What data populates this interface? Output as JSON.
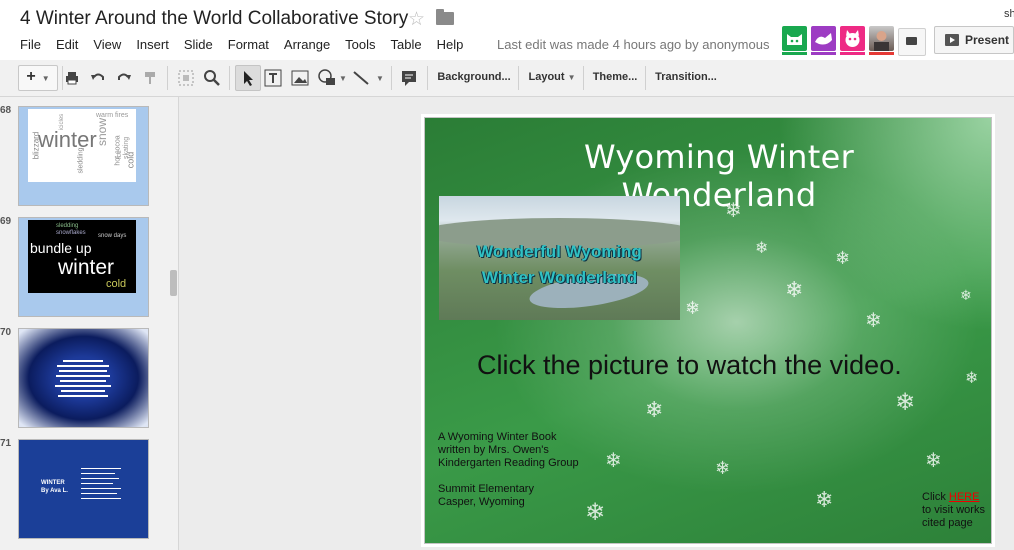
{
  "header": {
    "doc_title": "4 Winter Around the World Collaborative Story",
    "star_icon": "☆",
    "share_cut": "sh",
    "menu": [
      "File",
      "Edit",
      "View",
      "Insert",
      "Slide",
      "Format",
      "Arrange",
      "Tools",
      "Table",
      "Help"
    ],
    "last_edit": "Last edit was made 4 hours ago by anonymous",
    "present_label": "Present",
    "collaborators": [
      {
        "color": "#19a84f",
        "bar": "#19a84f",
        "glyph": "🐱"
      },
      {
        "color": "#9d3cc3",
        "bar": "#9d3cc3",
        "glyph": "🐈"
      },
      {
        "color": "#ee2a84",
        "bar": "#ee2a84",
        "glyph": "😺"
      },
      {
        "color": "#7a7a7a",
        "bar": "#e53935",
        "glyph": ""
      }
    ]
  },
  "toolbar": {
    "add_label": "+",
    "background_label": "Background...",
    "layout_label": "Layout",
    "theme_label": "Theme...",
    "transition_label": "Transition..."
  },
  "filmstrip": {
    "slides": [
      {
        "num": "68",
        "kind": "wordcloud-white",
        "words": [
          "winter",
          "snow",
          "blizzard",
          "cold",
          "hot cocoa",
          "warm fires",
          "ice skating",
          "sledding",
          "icicles"
        ]
      },
      {
        "num": "69",
        "kind": "wordcloud-black",
        "words": [
          "bundle up",
          "winter",
          "cold",
          "snowflakes",
          "sledding",
          "snow days"
        ]
      },
      {
        "num": "70",
        "kind": "blue-snow"
      },
      {
        "num": "71",
        "kind": "blue-text",
        "title": "WINTER",
        "author": "By Ava L."
      }
    ]
  },
  "slide": {
    "title": "Wyoming Winter Wonderland",
    "video_line1": "Wonderful Wyoming",
    "video_line2": "Winter Wonderland",
    "click_text": "Click the picture to watch the video.",
    "credit_lines": [
      "A Wyoming Winter Book",
      "written by Mrs. Owen's",
      "Kindergarten Reading Group",
      "",
      "Summit Elementary",
      "Casper, Wyoming"
    ],
    "works_click": "Click",
    "works_link": "HERE",
    "works_line2": "to visit works",
    "works_line3": "cited page"
  }
}
